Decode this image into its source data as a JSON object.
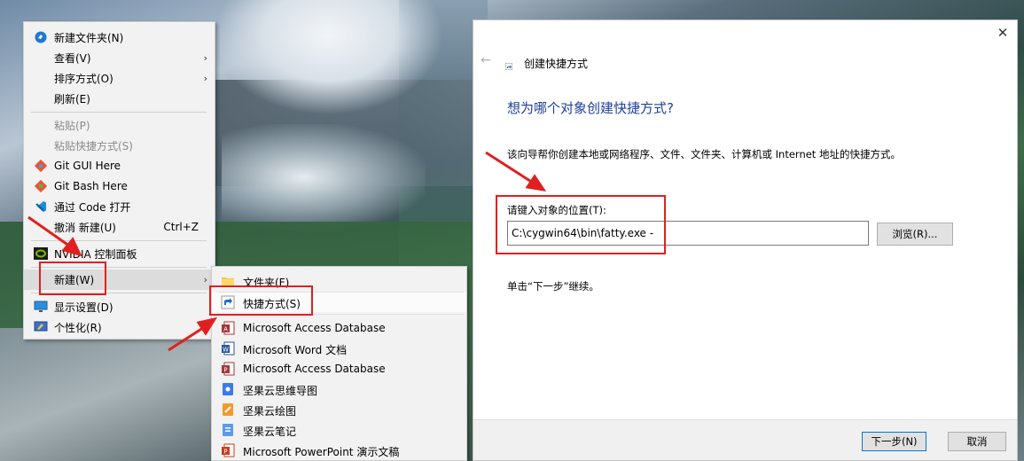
{
  "context_menu": {
    "items": [
      {
        "label": "新建文件夹(N)",
        "icon": "new-folder-icon"
      },
      {
        "label": "查看(V)",
        "arrow": "›"
      },
      {
        "label": "排序方式(O)",
        "arrow": "›"
      },
      {
        "label": "刷新(E)"
      },
      {
        "label": "粘贴(P)",
        "disabled": true
      },
      {
        "label": "粘贴快捷方式(S)",
        "disabled": true
      },
      {
        "label": "Git GUI Here",
        "icon": "git-icon"
      },
      {
        "label": "Git Bash Here",
        "icon": "git-icon"
      },
      {
        "label": "通过 Code 打开",
        "icon": "vscode-icon"
      },
      {
        "label": "撤消 新建(U)",
        "shortcut": "Ctrl+Z"
      },
      {
        "label": "NVIDIA 控制面板",
        "icon": "nvidia-icon"
      },
      {
        "label": "新建(W)",
        "arrow": "›"
      },
      {
        "label": "显示设置(D)",
        "icon": "display-icon"
      },
      {
        "label": "个性化(R)",
        "icon": "personalize-icon"
      }
    ]
  },
  "new_submenu": {
    "items": [
      {
        "label": "文件夹(F)",
        "icon": "folder-icon"
      },
      {
        "label": "快捷方式(S)",
        "icon": "shortcut-icon"
      },
      {
        "label": "Microsoft Access Database",
        "icon": "access-icon"
      },
      {
        "label": "Microsoft Word 文档",
        "icon": "word-icon"
      },
      {
        "label": "Microsoft Access Database",
        "icon": "access-icon"
      },
      {
        "label": "坚果云思维导图",
        "icon": "jianguoyun-mindmap-icon"
      },
      {
        "label": "坚果云绘图",
        "icon": "jianguoyun-draw-icon"
      },
      {
        "label": "坚果云笔记",
        "icon": "jianguoyun-note-icon"
      },
      {
        "label": "Microsoft PowerPoint 演示文稿",
        "icon": "powerpoint-icon"
      }
    ]
  },
  "dialog": {
    "close_glyph": "✕",
    "back_glyph": "←",
    "title": "创建快捷方式",
    "heading": "想为哪个对象创建快捷方式?",
    "description": "该向导帮你创建本地或网络程序、文件、文件夹、计算机或 Internet 地址的快捷方式。",
    "field_label": "请键入对象的位置(T):",
    "field_value": "C:\\cygwin64\\bin\\fatty.exe -",
    "browse_label": "浏览(R)...",
    "hint": "单击“下一步”继续。",
    "next_label": "下一步(N)",
    "cancel_label": "取消"
  },
  "colors": {
    "accent": "#0078d7",
    "heading": "#1e3f9c",
    "annotation": "#e02020"
  }
}
